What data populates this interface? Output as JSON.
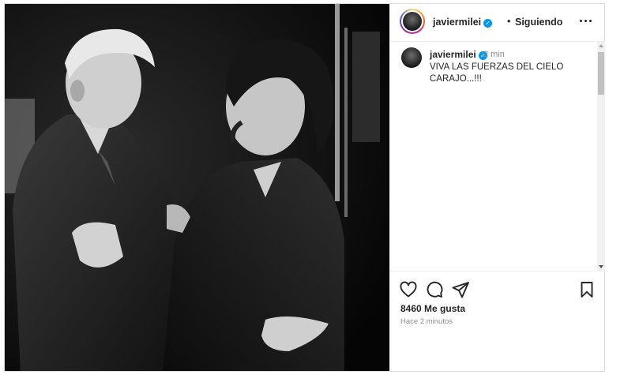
{
  "post": {
    "image_alt": "Black and white photo of two men embracing",
    "header": {
      "username": "javiermilei",
      "separator": "•",
      "follow_status": "Siguiendo"
    },
    "caption": {
      "username": "javiermilei",
      "time": "2 min",
      "text": "VIVA LAS FUERZAS DEL CIELO CARAJO...!!!"
    },
    "likes": "8460 Me gusta",
    "posted_ago": "Hace 2 minutos"
  },
  "colors": {
    "accent": "#0095f6",
    "text": "#262626",
    "muted": "#8e8e8e",
    "border": "#dbdbdb"
  }
}
